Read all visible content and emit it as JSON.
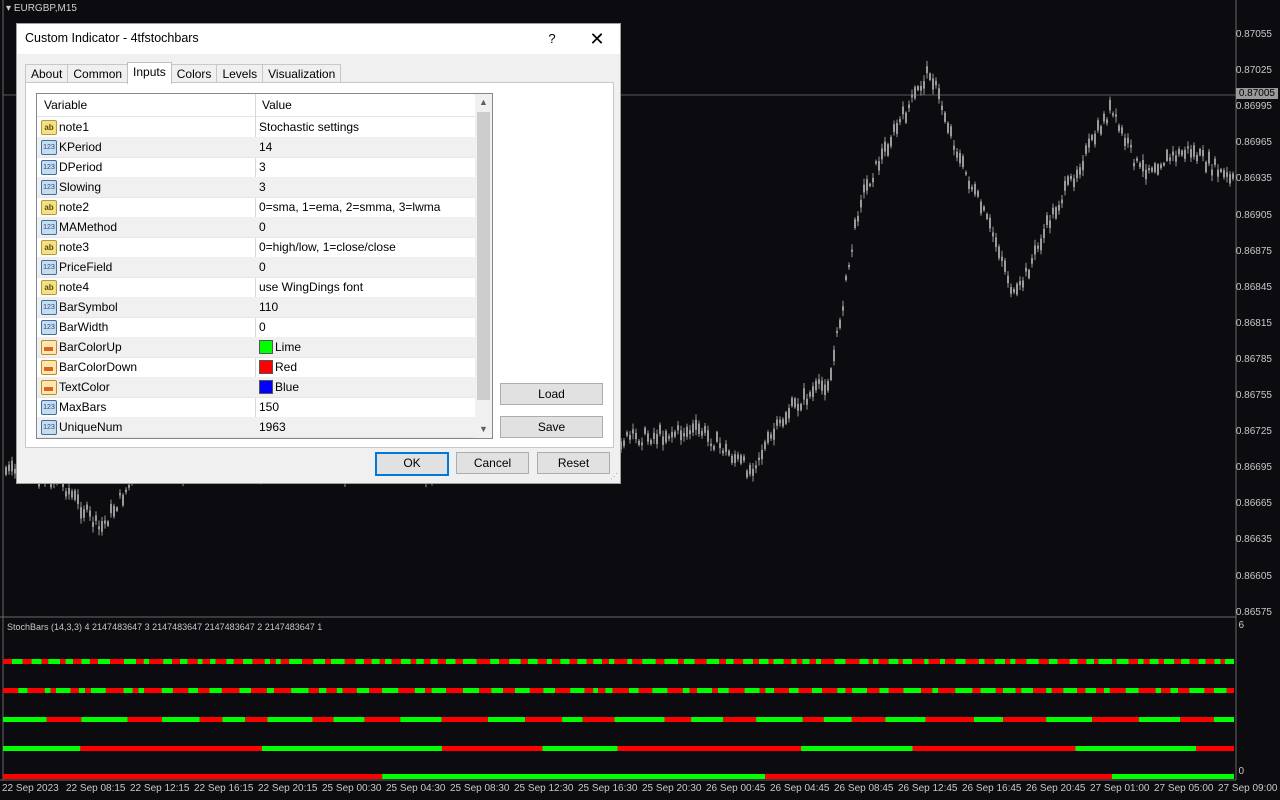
{
  "chart": {
    "symbol_label": "EURGBP,M15",
    "price_ticks": [
      "0.87055",
      "0.87025",
      "0.86995",
      "0.86965",
      "0.86935",
      "0.86905",
      "0.86875",
      "0.86845",
      "0.86815",
      "0.86785",
      "0.86755",
      "0.86725",
      "0.86695",
      "0.86665",
      "0.86635",
      "0.86605",
      "0.86575"
    ],
    "current_price": "0.87005",
    "time_ticks": [
      "22 Sep 2023",
      "22 Sep 08:15",
      "22 Sep 12:15",
      "22 Sep 16:15",
      "22 Sep 20:15",
      "25 Sep 00:30",
      "25 Sep 04:30",
      "25 Sep 08:30",
      "25 Sep 12:30",
      "25 Sep 16:30",
      "25 Sep 20:30",
      "26 Sep 00:45",
      "26 Sep 04:45",
      "26 Sep 08:45",
      "26 Sep 12:45",
      "26 Sep 16:45",
      "26 Sep 20:45",
      "27 Sep 01:00",
      "27 Sep 05:00",
      "27 Sep 09:00"
    ],
    "sub_window_title": "StochBars (14,3,3) 4 2147483647 3 2147483647 2147483647 2 2147483647 1",
    "sub_axis_top": "6",
    "sub_axis_bottom": "0",
    "colors": {
      "up": "#00ff00",
      "down": "#ff0000",
      "candle": "#9a9a9a",
      "background": "#0b0b10"
    }
  },
  "dialog": {
    "title": "Custom Indicator - 4tfstochbars",
    "help_label": "?",
    "close_label": "✕",
    "tabs": [
      {
        "label": "About"
      },
      {
        "label": "Common"
      },
      {
        "label": "Inputs"
      },
      {
        "label": "Colors"
      },
      {
        "label": "Levels"
      },
      {
        "label": "Visualization"
      }
    ],
    "active_tab": "Inputs",
    "grid": {
      "col_variable": "Variable",
      "col_value": "Value",
      "rows": [
        {
          "type": "str",
          "name": "note1",
          "value": "Stochastic settings"
        },
        {
          "type": "num",
          "name": "KPeriod",
          "value": "14"
        },
        {
          "type": "num",
          "name": "DPeriod",
          "value": "3"
        },
        {
          "type": "num",
          "name": "Slowing",
          "value": "3"
        },
        {
          "type": "str",
          "name": "note2",
          "value": "0=sma, 1=ema, 2=smma, 3=lwma"
        },
        {
          "type": "num",
          "name": "MAMethod",
          "value": "0"
        },
        {
          "type": "str",
          "name": "note3",
          "value": "0=high/low, 1=close/close"
        },
        {
          "type": "num",
          "name": "PriceField",
          "value": "0"
        },
        {
          "type": "str",
          "name": "note4",
          "value": "use WingDings font"
        },
        {
          "type": "num",
          "name": "BarSymbol",
          "value": "110"
        },
        {
          "type": "num",
          "name": "BarWidth",
          "value": "0"
        },
        {
          "type": "col",
          "name": "BarColorUp",
          "value": "Lime",
          "swatch": "#00ff00"
        },
        {
          "type": "col",
          "name": "BarColorDown",
          "value": "Red",
          "swatch": "#ff0000"
        },
        {
          "type": "col",
          "name": "TextColor",
          "value": "Blue",
          "swatch": "#0000ff"
        },
        {
          "type": "num",
          "name": "MaxBars",
          "value": "150"
        },
        {
          "type": "num",
          "name": "UniqueNum",
          "value": "1963"
        }
      ]
    },
    "buttons": {
      "load": "Load",
      "save": "Save",
      "ok": "OK",
      "cancel": "Cancel",
      "reset": "Reset"
    }
  }
}
